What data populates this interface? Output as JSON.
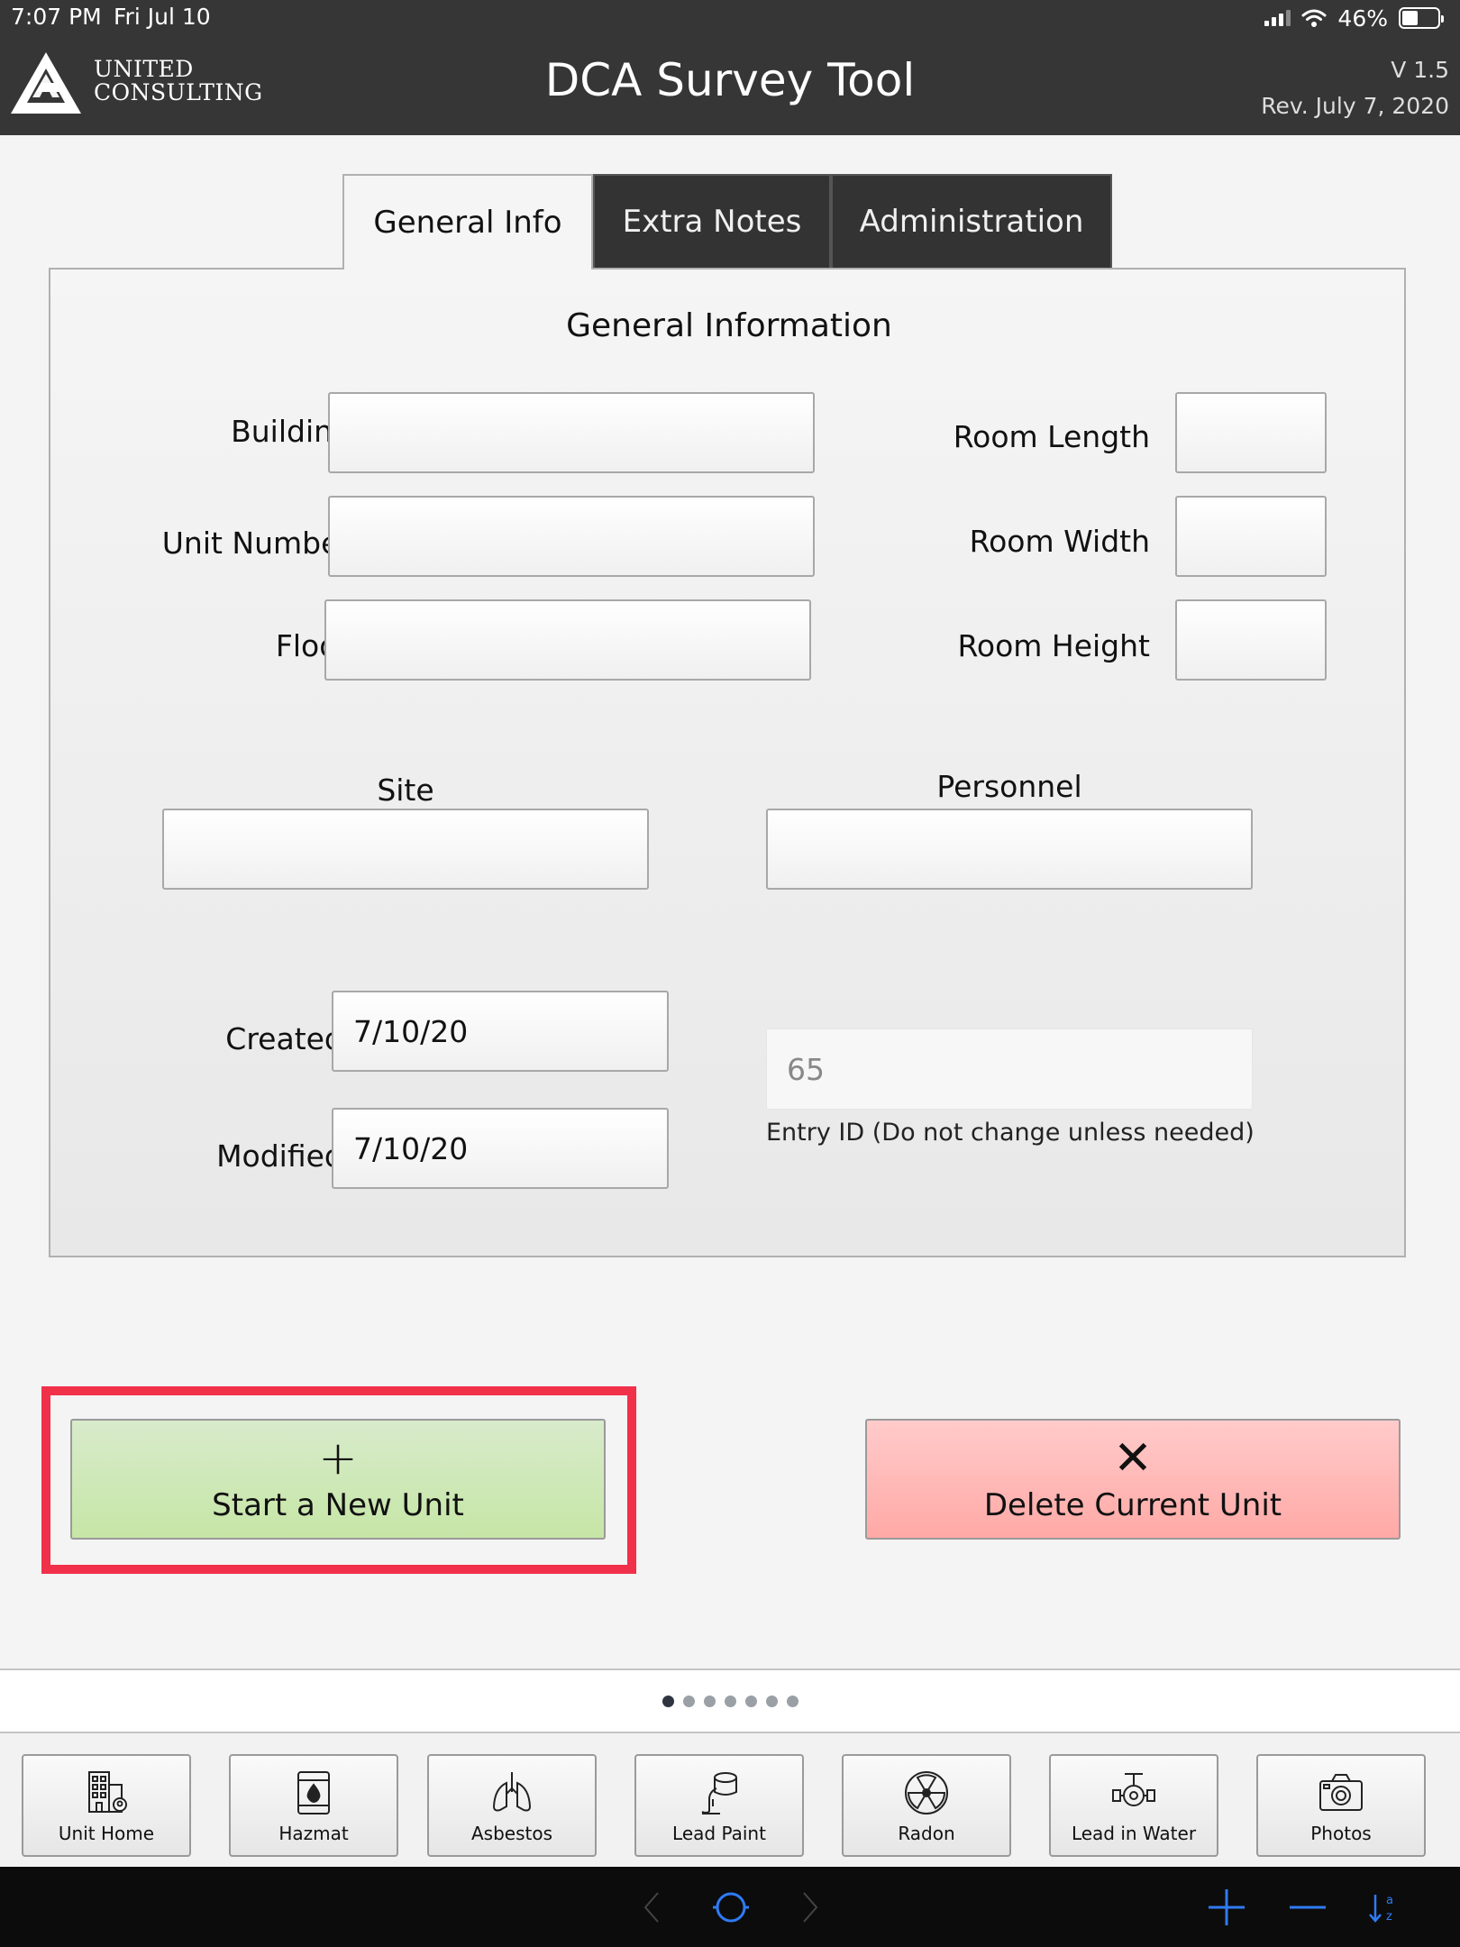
{
  "status_bar": {
    "time": "7:07 PM",
    "date": "Fri Jul 10",
    "battery": "46%"
  },
  "header": {
    "logo_line1": "UNITED",
    "logo_line2": "CONSULTING",
    "title": "DCA Survey Tool",
    "version": "V 1.5",
    "revision": "Rev. July 7, 2020"
  },
  "tabs": [
    {
      "label": "General Info",
      "active": true
    },
    {
      "label": "Extra Notes",
      "active": false
    },
    {
      "label": "Administration",
      "active": false
    }
  ],
  "form": {
    "title": "General Information",
    "building": {
      "label": "Building",
      "value": ""
    },
    "unit_number": {
      "label": "Unit Number",
      "value": ""
    },
    "floor": {
      "label": "Floor",
      "value": ""
    },
    "room_length": {
      "label": "Room Length",
      "value": ""
    },
    "room_width": {
      "label": "Room Width",
      "value": ""
    },
    "room_height": {
      "label": "Room Height",
      "value": ""
    },
    "site": {
      "label": "Site",
      "value": ""
    },
    "personnel": {
      "label": "Personnel",
      "value": ""
    },
    "created": {
      "label": "Created:",
      "value": "7/10/20"
    },
    "modified": {
      "label": "Modified:",
      "value": "7/10/20"
    },
    "entry_id": {
      "value": "65",
      "hint": "Entry ID (Do not change unless needed)"
    }
  },
  "actions": {
    "new_unit": {
      "symbol": "+",
      "label": "Start a New Unit"
    },
    "delete_unit": {
      "symbol": "✕",
      "label": "Delete Current Unit"
    }
  },
  "pager": {
    "pages": 7,
    "current": 1
  },
  "bottom_nav": [
    {
      "label": "Unit Home",
      "icon": "building-icon"
    },
    {
      "label": "Hazmat",
      "icon": "hazmat-barrel-icon"
    },
    {
      "label": "Asbestos",
      "icon": "lungs-icon"
    },
    {
      "label": "Lead Paint",
      "icon": "paint-can-icon"
    },
    {
      "label": "Radon",
      "icon": "radiation-icon"
    },
    {
      "label": "Lead in Water",
      "icon": "water-valve-icon"
    },
    {
      "label": "Photos",
      "icon": "camera-icon"
    }
  ],
  "colors": {
    "header_bg": "#363636",
    "new_unit_button": "#c6e6a6",
    "delete_button": "#ffa9a6",
    "highlight_border": "#f1304a",
    "browser_accent": "#2f7bf5"
  }
}
